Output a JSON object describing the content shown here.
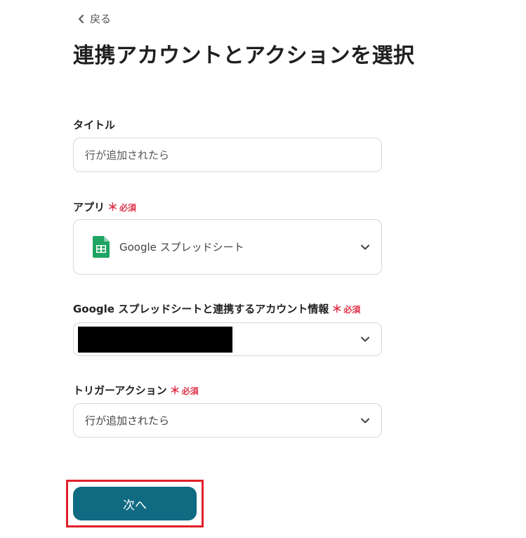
{
  "nav": {
    "back_label": "戻る"
  },
  "page": {
    "title": "連携アカウントとアクションを選択"
  },
  "required_mark": "＊",
  "form": {
    "title_field": {
      "label": "タイトル",
      "value": "行が追加されたら"
    },
    "app_field": {
      "label": "アプリ",
      "required_label": "必須",
      "selected": "Google スプレッドシート",
      "icon": "google-sheets-icon"
    },
    "account_field": {
      "label": "Google スプレッドシートと連携するアカウント情報",
      "required_label": "必須"
    },
    "trigger_field": {
      "label": "トリガーアクション",
      "required_label": "必須",
      "selected": "行が追加されたら"
    }
  },
  "footer": {
    "next_label": "次へ"
  },
  "colors": {
    "primary": "#0f6a82",
    "required": "#e0334a",
    "highlight": "#e0202a",
    "sheets_green": "#1fa463"
  }
}
